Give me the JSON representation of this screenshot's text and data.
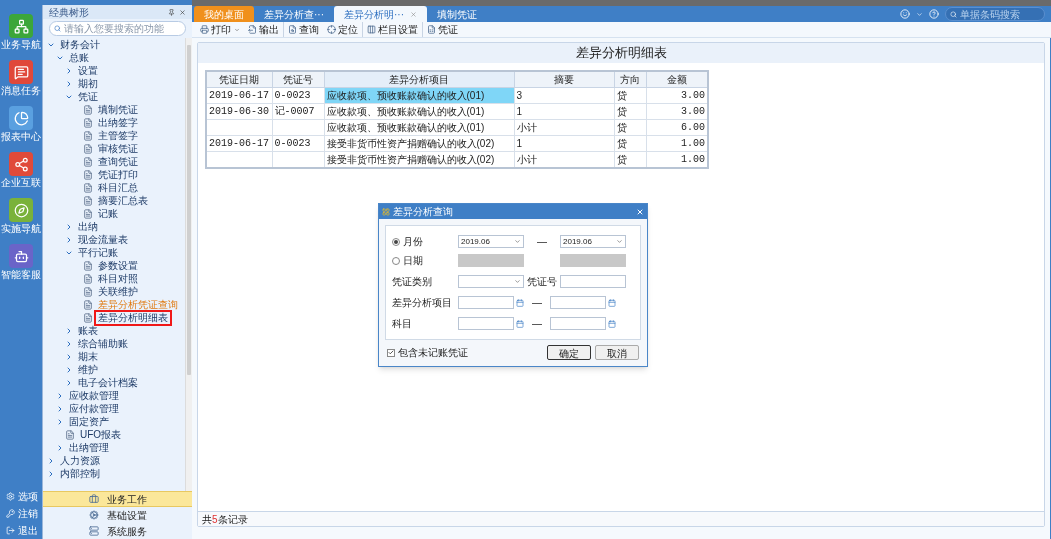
{
  "nav": {
    "items": [
      {
        "label": "业务导航",
        "kind": "tree"
      },
      {
        "label": "消息任务",
        "kind": "message"
      },
      {
        "label": "报表中心",
        "kind": "report"
      },
      {
        "label": "企业互联",
        "kind": "network"
      },
      {
        "label": "实施导航",
        "kind": "guide"
      },
      {
        "label": "智能客服",
        "kind": "service"
      }
    ],
    "bottom": [
      {
        "label": "选项",
        "kind": "gear"
      },
      {
        "label": "注销",
        "kind": "key"
      },
      {
        "label": "退出",
        "kind": "exit"
      }
    ]
  },
  "tree_panel": {
    "title": "经典树形",
    "search_placeholder": "请输入您要搜索的功能",
    "items": [
      {
        "label": "财务会计",
        "expanded": true,
        "children": [
          {
            "label": "总账",
            "expanded": true,
            "children": [
              {
                "label": "设置",
                "expanded": false
              },
              {
                "label": "期初",
                "expanded": false
              },
              {
                "label": "凭证",
                "expanded": true,
                "children": [
                  {
                    "label": "填制凭证",
                    "selected": false,
                    "hovered": false
                  },
                  {
                    "label": "出纳签字",
                    "selected": false,
                    "hovered": false
                  },
                  {
                    "label": "主管签字",
                    "selected": false,
                    "hovered": false
                  },
                  {
                    "label": "审核凭证",
                    "selected": false,
                    "hovered": false
                  },
                  {
                    "label": "查询凭证",
                    "selected": false,
                    "hovered": false
                  },
                  {
                    "label": "凭证打印",
                    "selected": false,
                    "hovered": false
                  },
                  {
                    "label": "科目汇总",
                    "selected": false,
                    "hovered": false
                  },
                  {
                    "label": "摘要汇总表",
                    "selected": false,
                    "hovered": false
                  },
                  {
                    "label": "记账",
                    "selected": false,
                    "hovered": false
                  }
                ]
              },
              {
                "label": "出纳",
                "expanded": false
              },
              {
                "label": "现金流量表",
                "expanded": false
              },
              {
                "label": "平行记账",
                "expanded": true,
                "children": [
                  {
                    "label": "参数设置",
                    "selected": false,
                    "hovered": false
                  },
                  {
                    "label": "科目对照",
                    "selected": false,
                    "hovered": false
                  },
                  {
                    "label": "关联维护",
                    "selected": false,
                    "hovered": false
                  },
                  {
                    "label": "差异分析凭证查询",
                    "selected": false,
                    "hovered": true
                  },
                  {
                    "label": "差异分析明细表",
                    "selected": true,
                    "hovered": false
                  }
                ]
              },
              {
                "label": "账表",
                "expanded": false
              },
              {
                "label": "综合辅助账",
                "expanded": false
              },
              {
                "label": "期末",
                "expanded": false
              },
              {
                "label": "维护",
                "expanded": false
              },
              {
                "label": "电子会计档案",
                "expanded": false
              }
            ]
          },
          {
            "label": "应收款管理",
            "expanded": false
          },
          {
            "label": "应付款管理",
            "expanded": false
          },
          {
            "label": "固定资产",
            "expanded": false
          },
          {
            "label": "UFO报表",
            "selected": false,
            "hovered": false
          },
          {
            "label": "出纳管理",
            "expanded": false
          }
        ]
      },
      {
        "label": "人力资源",
        "expanded": false
      },
      {
        "label": "内部控制",
        "expanded": false
      }
    ],
    "modules": [
      {
        "label": "业务工作",
        "kind": "work",
        "selected": true
      },
      {
        "label": "基础设置",
        "kind": "settings",
        "selected": false
      },
      {
        "label": "系统服务",
        "kind": "system",
        "selected": false
      }
    ]
  },
  "tabs": [
    {
      "label": "我的桌面",
      "kind": "home",
      "selected": false,
      "closable": false
    },
    {
      "label": "差异分析查···",
      "kind": "page",
      "selected": false,
      "closable": false
    },
    {
      "label": "差异分析明···",
      "kind": "page",
      "selected": true,
      "closable": true
    },
    {
      "label": "填制凭证",
      "kind": "page",
      "selected": false,
      "closable": false
    }
  ],
  "header": {
    "search_placeholder": "单据条码搜索"
  },
  "toolbar": [
    [
      {
        "label": "打印",
        "kind": "print",
        "dropdown": true
      },
      {
        "label": "输出",
        "kind": "export",
        "dropdown": false
      }
    ],
    [
      {
        "label": "查询",
        "kind": "query",
        "dropdown": false
      },
      {
        "label": "定位",
        "kind": "locate",
        "dropdown": false
      }
    ],
    [
      {
        "label": "栏目设置",
        "kind": "columns",
        "dropdown": false
      }
    ],
    [
      {
        "label": "凭证",
        "kind": "voucher",
        "dropdown": false
      }
    ]
  ],
  "report": {
    "title": "差异分析明细表",
    "columns": [
      "凭证日期",
      "凭证号",
      "差异分析项目",
      "摘要",
      "方向",
      "金额"
    ],
    "rows": [
      {
        "selected": true,
        "cells": [
          "2019-06-17",
          "0-0023",
          "应收款项、预收账款确认的收入(01)",
          "3",
          "贷",
          "3.00"
        ]
      },
      {
        "selected": false,
        "cells": [
          "2019-06-30",
          "记-0007",
          "应收款项、预收账款确认的收入(01)",
          "1",
          "贷",
          "3.00"
        ]
      },
      {
        "selected": false,
        "cells": [
          "",
          "",
          "应收款项、预收账款确认的收入(01)",
          "小计",
          "贷",
          "6.00"
        ]
      },
      {
        "selected": false,
        "cells": [
          "2019-06-17",
          "0-0023",
          "接受非货币性资产捐赠确认的收入(02)",
          "1",
          "贷",
          "1.00"
        ]
      },
      {
        "selected": false,
        "cells": [
          "",
          "",
          "接受非货币性资产捐赠确认的收入(02)",
          "小计",
          "贷",
          "1.00"
        ]
      }
    ],
    "status": {
      "prefix": "共",
      "count": "5",
      "suffix": "条记录"
    }
  },
  "dialog": {
    "title": "差异分析查询",
    "period_options": [
      {
        "label": "月份",
        "selected": true
      },
      {
        "label": "日期",
        "selected": false
      }
    ],
    "month_from": "2019.06",
    "month_to": "2019.06",
    "dash": "—",
    "voucher_type_label": "凭证类别",
    "voucher_no_label": "凭证号",
    "item_label": "差异分析项目",
    "subject_label": "科目",
    "include_unposted": {
      "label": "包含未记账凭证",
      "checked": true
    },
    "buttons": [
      "确定",
      "取消"
    ]
  }
}
